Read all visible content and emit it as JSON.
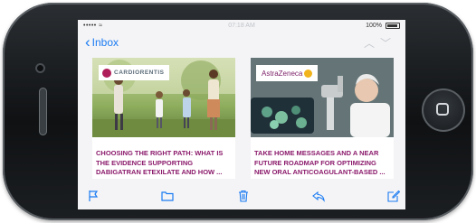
{
  "status_bar": {
    "signal": "••••• ≈",
    "time": "07:18 AM",
    "battery": "100%"
  },
  "navigation": {
    "back_label": "Inbox"
  },
  "cards": [
    {
      "brand": "CARDIORENTIS",
      "title": "CHOOSING THE RIGHT PATH: WHAT IS THE EVIDENCE SUPPORTING DABIGATRAN ETEXILATE AND HOW ..."
    },
    {
      "brand": "AstraZeneca",
      "title": "TAKE HOME MESSAGES AND A NEAR FUTURE ROADMAP FOR OPTIMIZING NEW ORAL ANTICOAGULANT-BASED ..."
    }
  ],
  "toolbar_icons": [
    "flag-icon",
    "folder-icon",
    "trash-icon",
    "reply-icon",
    "compose-icon"
  ],
  "colors": {
    "accent": "#1a7bf2",
    "title": "#8b1a6b"
  }
}
